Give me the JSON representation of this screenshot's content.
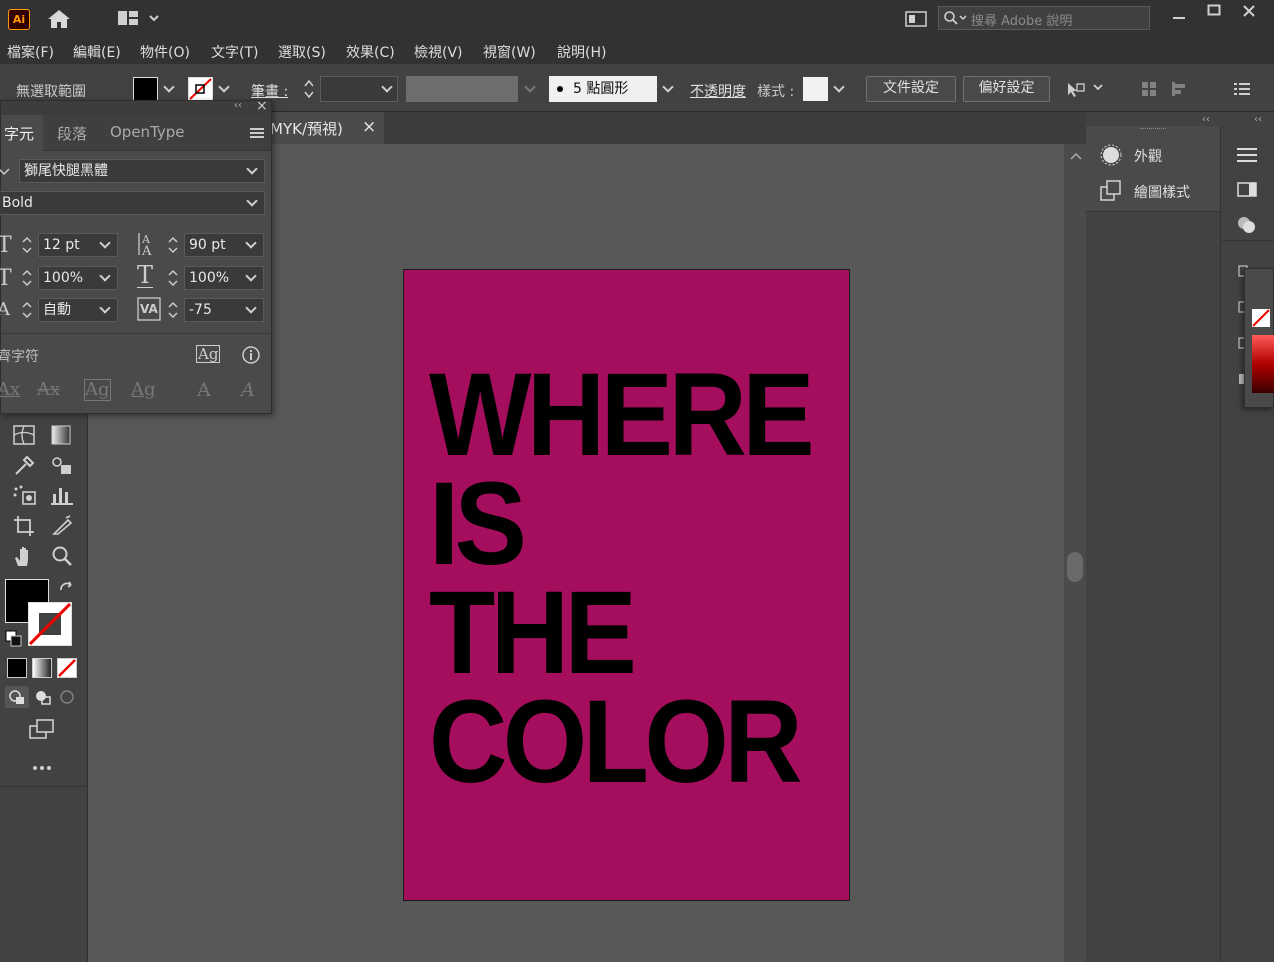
{
  "app": {
    "logo": "Ai",
    "search_placeholder": "搜尋 Adobe 說明"
  },
  "menu": [
    "檔案(F)",
    "編輯(E)",
    "物件(O)",
    "文字(T)",
    "選取(S)",
    "效果(C)",
    "檢視(V)",
    "視窗(W)",
    "說明(H)"
  ],
  "control_bar": {
    "no_selection": "無選取範圍",
    "stroke_label": "筆畫 :",
    "brush": "5 點圓形",
    "opacity": "不透明度",
    "style": "樣式 :",
    "doc_setup": "文件設定",
    "preferences": "偏好設定"
  },
  "document_tab": {
    "title": "MYK/預視)",
    "close": "×"
  },
  "character_panel": {
    "tabs": [
      "字元",
      "段落",
      "OpenType"
    ],
    "font_family": "獅尾快腿黑體",
    "font_style": "Bold",
    "font_size": "12 pt",
    "leading": "90 pt",
    "vertical_scale": "100%",
    "horizontal_scale": "100%",
    "kerning": "自動",
    "tracking": "-75",
    "snap_label": "齊字符"
  },
  "right_panel": {
    "appearance": "外觀",
    "graphic_styles": "繪圖樣式"
  },
  "artwork": {
    "lines": [
      "WHERE",
      "IS",
      "THE",
      "COLOR"
    ],
    "background": "#a50d5d",
    "text_color": "#000000"
  }
}
